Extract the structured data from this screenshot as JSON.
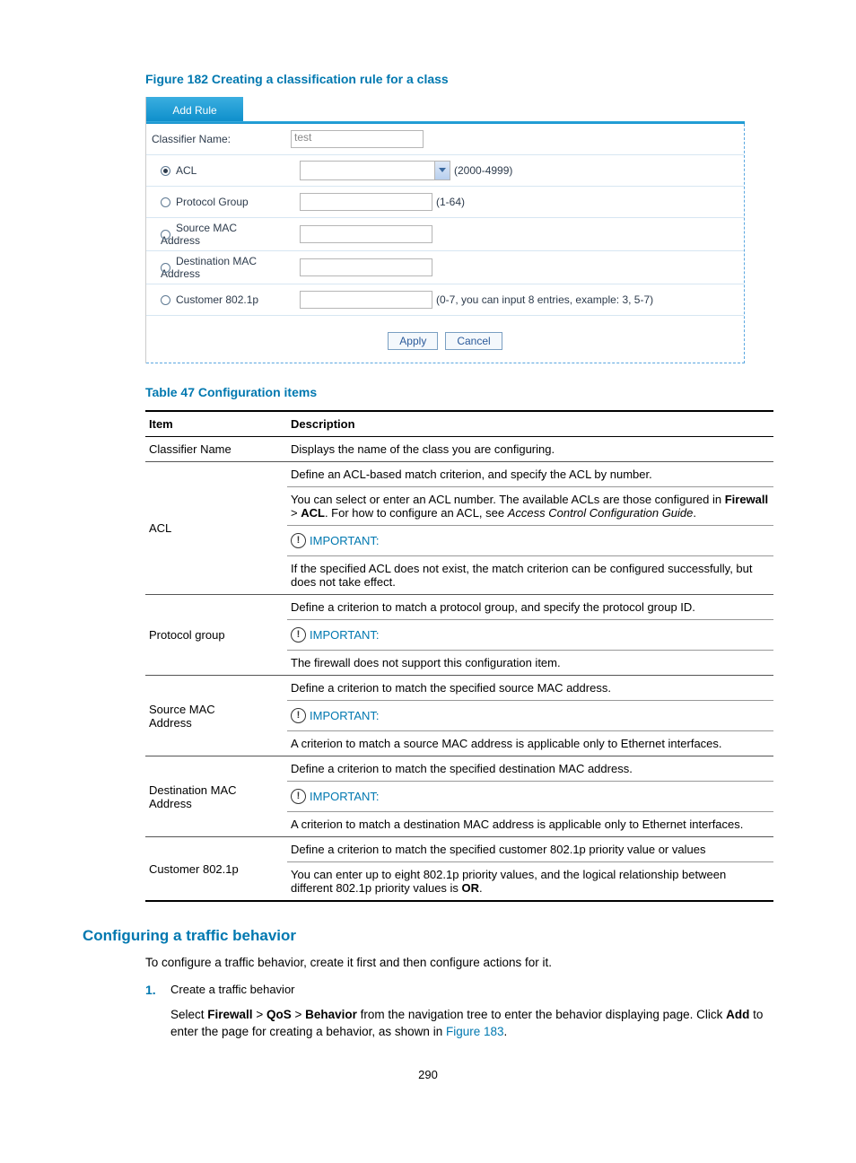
{
  "figure": {
    "caption": "Figure 182 Creating a classification rule for a class",
    "tab": "Add Rule",
    "rows": {
      "classifier_label": "Classifier Name:",
      "classifier_value": "test",
      "acl_label": "ACL",
      "acl_hint": "(2000-4999)",
      "protocol_label": "Protocol Group",
      "protocol_hint": "(1-64)",
      "srcmac_label1": "Source MAC",
      "srcmac_label2": "Address",
      "dstmac_label1": "Destination MAC",
      "dstmac_label2": "Address",
      "cust_label": "Customer 802.1p",
      "cust_hint": "(0-7, you can input 8 entries, example: 3, 5-7)"
    },
    "buttons": {
      "apply": "Apply",
      "cancel": "Cancel"
    }
  },
  "table": {
    "caption": "Table 47 Configuration items",
    "head_item": "Item",
    "head_desc": "Description",
    "classifier": {
      "item": "Classifier Name",
      "desc": "Displays the name of the class you are configuring."
    },
    "acl": {
      "item": "ACL",
      "d1": "Define an ACL-based match criterion, and specify the ACL by number.",
      "d2a": "You can select or enter an ACL number. The available ACLs are those configured in ",
      "d2b": "Firewall",
      "d2c": " > ",
      "d2d": "ACL",
      "d2e": ". For how to configure an ACL, see ",
      "d2f": "Access Control Configuration Guide",
      "d2g": ".",
      "important": "IMPORTANT:",
      "d3": "If the specified ACL does not exist, the match criterion can be configured successfully, but does not take effect."
    },
    "protocol": {
      "item": "Protocol group",
      "d1": "Define a criterion to match a protocol group, and specify the protocol group ID.",
      "important": "IMPORTANT:",
      "d2": "The firewall does not support this configuration item."
    },
    "srcmac": {
      "item1": "Source MAC",
      "item2": "Address",
      "d1": "Define a criterion to match the specified source MAC address.",
      "important": "IMPORTANT:",
      "d2": "A criterion to match a source MAC address is applicable only to Ethernet interfaces."
    },
    "dstmac": {
      "item1": "Destination MAC",
      "item2": "Address",
      "d1": "Define a criterion to match the specified destination MAC address.",
      "important": "IMPORTANT:",
      "d2": "A criterion to match a destination MAC address is applicable only to Ethernet interfaces."
    },
    "cust": {
      "item": "Customer 802.1p",
      "d1": "Define a criterion to match the specified customer 802.1p priority value or values",
      "d2a": "You can enter up to eight 802.1p priority values, and the logical relationship between different 802.1p priority values is ",
      "d2b": "OR",
      "d2c": "."
    }
  },
  "section": {
    "heading": "Configuring a traffic behavior",
    "intro": "To configure a traffic behavior, create it first and then configure actions for it.",
    "step_num": "1.",
    "step_text": "Create a traffic behavior",
    "p2a": "Select ",
    "p2b": "Firewall",
    "p2c": " > ",
    "p2d": "QoS",
    "p2e": " > ",
    "p2f": "Behavior",
    "p2g": " from the navigation tree to enter the behavior displaying page. Click ",
    "p2h": "Add",
    "p2i": " to enter the page for creating a behavior, as shown in ",
    "p2j": "Figure 183",
    "p2k": "."
  },
  "page_number": "290"
}
